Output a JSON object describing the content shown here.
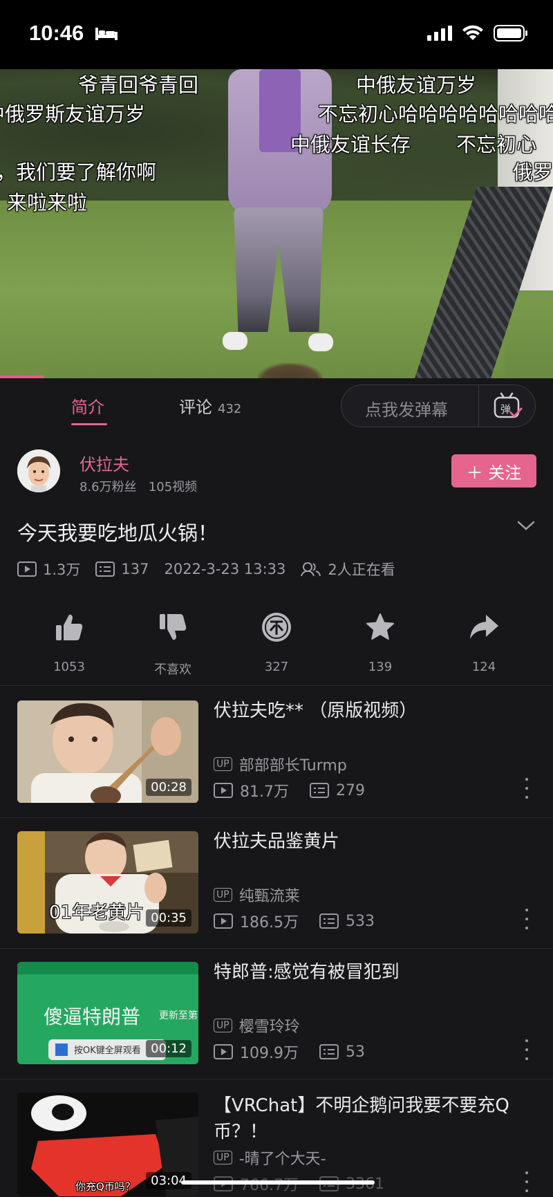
{
  "status_bar": {
    "time": "10:46"
  },
  "video": {
    "danmaku": [
      "爷青回爷青回",
      "中俄友谊万岁",
      "中俄罗斯友谊万岁",
      "不忘初心哈哈哈哈哈哈哈哈哈",
      "中俄友谊长存",
      "不忘初心",
      "，我们要了解你啊",
      "俄罗",
      "来啦来啦"
    ],
    "progress_fraction": 0.08
  },
  "tabs": {
    "intro_label": "简介",
    "comments_label": "评论",
    "comments_count": "432",
    "danmaku_placeholder": "点我发弹幕"
  },
  "uploader": {
    "name": "伏拉夫",
    "followers": "8.6万粉丝",
    "videos": "105视频",
    "follow_label": "＋ 关注"
  },
  "main_video": {
    "title": "今天我要吃地瓜火锅！",
    "views": "1.3万",
    "danmaku_count": "137",
    "publish_time": "2022-3-23 13:33",
    "watching": "2人正在看"
  },
  "actions": {
    "like": "1053",
    "dislike": "不喜欢",
    "coin": "327",
    "favorite": "139",
    "share": "124"
  },
  "recommendations": [
    {
      "title": "伏拉夫吃**  （原版视频）",
      "author": "部部部长Turmp",
      "views": "81.7万",
      "danmaku": "279",
      "duration": "00:28",
      "thumb_caption": ""
    },
    {
      "title": "伏拉夫品鉴黄片",
      "author": "纯甄流莱",
      "views": "186.5万",
      "danmaku": "533",
      "duration": "00:35",
      "thumb_caption": "01年老黄片"
    },
    {
      "title": "特郎普:感觉有被冒犯到",
      "author": "樱雪玲玲",
      "views": "109.9万",
      "danmaku": "53",
      "duration": "00:12",
      "thumb_caption": "傻逼特朗普"
    },
    {
      "title": "【VRChat】不明企鹅问我要不要充Q币？！",
      "author": "-晴了个大天-",
      "views": "766.7万",
      "danmaku": "3361",
      "duration": "03:04",
      "thumb_caption": "你充Q币吗？"
    }
  ],
  "colors": {
    "accent": "#e6658f",
    "background": "#17171a"
  }
}
